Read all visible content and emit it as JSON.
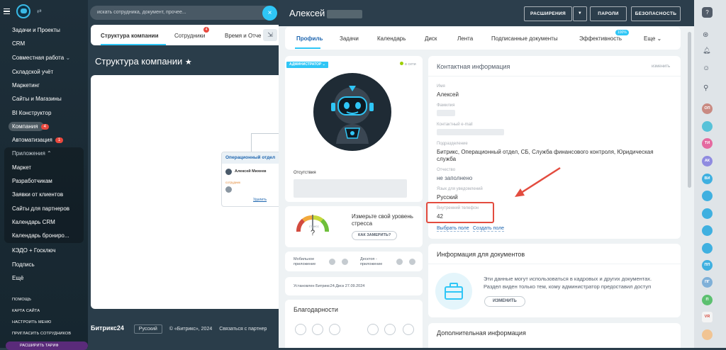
{
  "left_nav": {
    "items": [
      {
        "label": "Задачи и Проекты"
      },
      {
        "label": "CRM"
      },
      {
        "label": "Совместная работа",
        "chevron": "⌄"
      },
      {
        "label": "Складской учёт"
      },
      {
        "label": "Маркетинг"
      },
      {
        "label": "Сайты и Магазины"
      },
      {
        "label": "BI Конструктор"
      },
      {
        "label": "Компания",
        "badge": "4"
      },
      {
        "label": "Автоматизация",
        "badge": "1"
      }
    ],
    "apps_group": {
      "label": "Приложения",
      "items": [
        "Маркет",
        "Разработчикам",
        "Заявки от клиентов",
        "Сайты для партнеров",
        "Календарь CRM",
        "Календарь брониро..."
      ]
    },
    "bottom_items": [
      "КЭДО + Госключ",
      "Подпись",
      "Ещё"
    ],
    "footer_links": [
      "ПОМОЩЬ",
      "КАРТА САЙТА",
      "НАСТРОИТЬ МЕНЮ",
      "ПРИГЛАСИТЬ СОТРУДНИКОВ",
      "РАСШИРИТЬ ТАРИФ"
    ]
  },
  "background_page": {
    "search_placeholder": "искать сотрудника, документ, прочее...",
    "tabs": [
      {
        "label": "Структура компании"
      },
      {
        "label": "Сотрудники",
        "badge": "4"
      },
      {
        "label": "Время и Отче"
      }
    ],
    "title": "Структура компании",
    "dept_card": {
      "title": "Операционный отдел",
      "person": "Алексей Михеев",
      "role": "сотрудник",
      "link": "Удалить"
    },
    "footer": {
      "logo": "Битрикс24",
      "lang": "Русский",
      "copyright": "© «Битрикс», 2024",
      "link": "Связаться с партнер"
    }
  },
  "panel": {
    "title": "Алексей",
    "buttons": {
      "extensions": "РАСШИРЕНИЯ",
      "passwords": "ПАРОЛИ",
      "security": "БЕЗОПАСНОСТЬ"
    },
    "tabs": [
      {
        "label": "Профиль",
        "active": true
      },
      {
        "label": "Задачи"
      },
      {
        "label": "Календарь"
      },
      {
        "label": "Диск"
      },
      {
        "label": "Лента"
      },
      {
        "label": "Подписанные документы"
      },
      {
        "label": "Эффективность",
        "badge": "100%"
      },
      {
        "label": "Еще"
      }
    ],
    "profile_card": {
      "role_badge": "АДМИНИСТРАТОР",
      "status": "в сети",
      "absence_label": "Отсутствия"
    },
    "stress_card": {
      "gauge_label": "стресс",
      "gauge_value": "?",
      "text": "Измерьте свой уровень стресса",
      "button": "КАК ЗАМЕРИТЬ?"
    },
    "apps_card": {
      "mobile": "Мобильное приложение",
      "desktop": "Десктоп - приложение"
    },
    "disk_card": {
      "text": "Установлен Битрикс24.Диск 27.09.2024"
    },
    "thanks_card": {
      "title": "Благодарности"
    },
    "contact_card": {
      "title": "Контактная информация",
      "edit": "изменить",
      "fields": [
        {
          "label": "Имя",
          "value": "Алексей"
        },
        {
          "label": "Фамилия",
          "value": ""
        },
        {
          "label": "Контактный e-mail",
          "value": ""
        },
        {
          "label": "Подразделение",
          "value": "Битрикс, Операционный отдел, СБ, Служба финансового контроля, Юридическая служба"
        },
        {
          "label": "Отчество",
          "value": "не заполнено"
        },
        {
          "label": "Язык для уведомлений",
          "value": "Русский"
        },
        {
          "label": "Внутренний телефон",
          "value": "42"
        }
      ],
      "links": [
        "Выбрать поле",
        "Создать поле"
      ]
    },
    "docs_card": {
      "title": "Информация для документов",
      "text": "Эти данные могут использоваться в кадровых и других документах. Раздел виден только тем, кому администратор предоставил доступ",
      "button": "ИЗМЕНИТЬ"
    },
    "extra_card": {
      "title": "Дополнительная информация"
    }
  },
  "right_bar": {
    "avatars": [
      {
        "text": "ОП",
        "color": "#c98a82"
      },
      {
        "text": "",
        "color": "#58c2d8"
      },
      {
        "text": "ТИ",
        "color": "#e56aa0"
      },
      {
        "text": "АК",
        "color": "#8f8be0"
      },
      {
        "text": "ВИ",
        "color": "#3fb0e0"
      },
      {
        "text": "",
        "color": "#3fb0e0"
      },
      {
        "text": "",
        "color": "#3fb0e0"
      },
      {
        "text": "",
        "color": "#3fb0e0"
      },
      {
        "text": "",
        "color": "#3fb0e0"
      },
      {
        "text": "ПП",
        "color": "#3fb0e0"
      },
      {
        "text": "ПГ",
        "color": "#7fb0d8"
      },
      {
        "text": "П",
        "color": "#5cc070"
      },
      {
        "text": "VR",
        "color": "#f4f4f4"
      }
    ]
  },
  "colors": {
    "accent": "#2fc6f6",
    "annotation_red": "#e34c3f",
    "nav_bg": "#1e2f3a",
    "topbar": "#2c3e4c"
  }
}
